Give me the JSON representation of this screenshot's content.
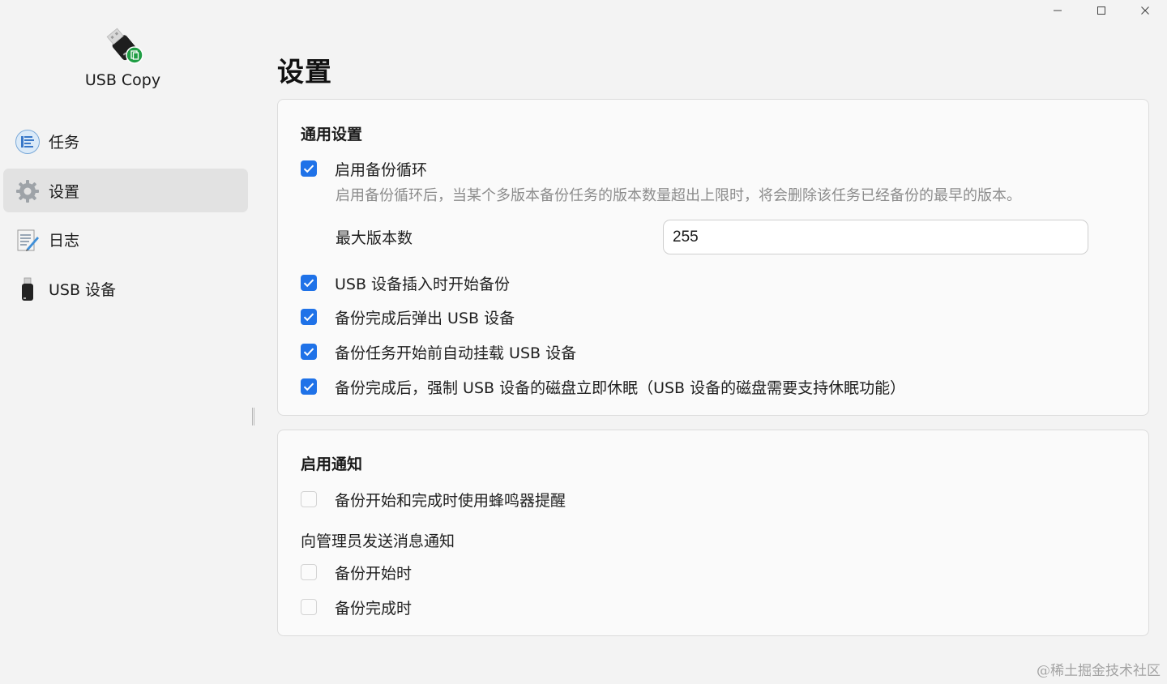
{
  "window": {
    "controls": {
      "minimize_icon": "minimize-icon",
      "maximize_icon": "maximize-icon",
      "close_icon": "close-icon"
    }
  },
  "sidebar": {
    "app_name": "USB Copy",
    "logo_icon": "usb-drive-copy-icon",
    "items": [
      {
        "label": "任务",
        "icon": "task-list-icon",
        "active": false
      },
      {
        "label": "设置",
        "icon": "gear-icon",
        "active": true
      },
      {
        "label": "日志",
        "icon": "log-notepad-icon",
        "active": false
      },
      {
        "label": "USB 设备",
        "icon": "usb-device-icon",
        "active": false
      }
    ]
  },
  "main": {
    "title": "设置",
    "general": {
      "title": "通用设置",
      "backup_cycle": {
        "label": "启用备份循环",
        "checked": true,
        "description": "启用备份循环后，当某个多版本备份任务的版本数量超出上限时，将会删除该任务已经备份的最早的版本。",
        "max_versions_label": "最大版本数",
        "max_versions_value": "255"
      },
      "options": [
        {
          "label": "USB 设备插入时开始备份",
          "checked": true
        },
        {
          "label": "备份完成后弹出 USB 设备",
          "checked": true
        },
        {
          "label": "备份任务开始前自动挂载 USB 设备",
          "checked": true
        },
        {
          "label": "备份完成后，强制 USB 设备的磁盘立即休眠（USB 设备的磁盘需要支持休眠功能）",
          "checked": true
        }
      ]
    },
    "notify": {
      "title": "启用通知",
      "buzzer": {
        "label": "备份开始和完成时使用蜂鸣器提醒",
        "checked": false
      },
      "admin_heading": "向管理员发送消息通知",
      "admin_options": [
        {
          "label": "备份开始时",
          "checked": false
        },
        {
          "label": "备份完成时",
          "checked": false
        }
      ]
    }
  },
  "watermark": "@稀土掘金技术社区",
  "colors": {
    "accent": "#1f72e8",
    "background": "#f3f3f3",
    "card": "#fafafa",
    "active_nav": "#e2e2e2",
    "muted_text": "#8c8c8c"
  }
}
